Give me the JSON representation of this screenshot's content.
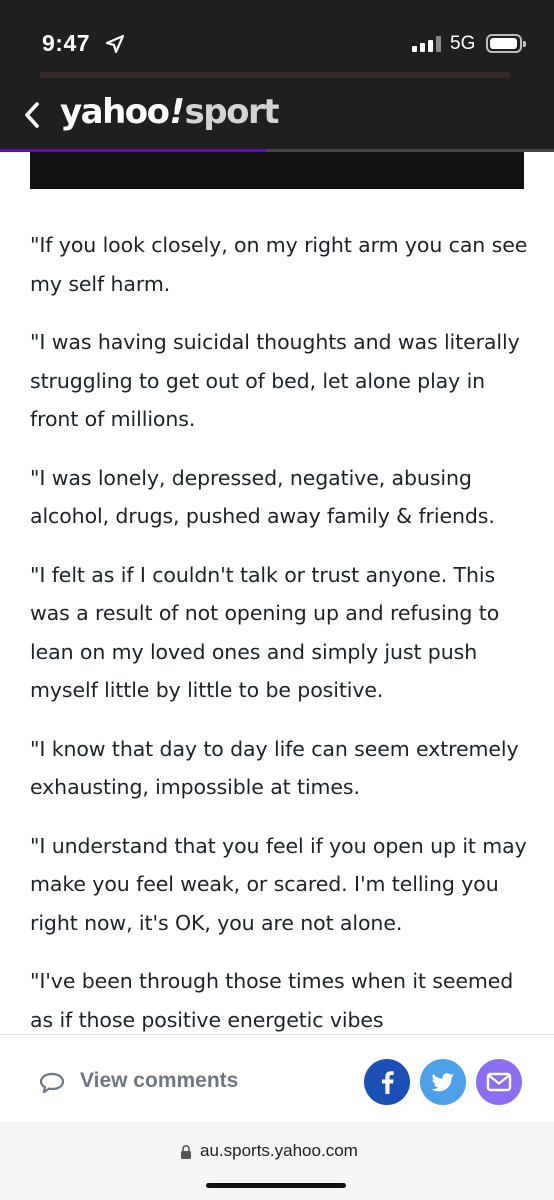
{
  "status_bar": {
    "time": "9:47",
    "network": "5G",
    "icons": [
      "location-arrow-icon",
      "signal-icon",
      "battery-icon"
    ]
  },
  "header": {
    "back_icon": "chevron-left-icon",
    "logo_main": "yahoo",
    "logo_excl": "!",
    "logo_sport": "sport",
    "read_progress": 0.48,
    "accent_color": "#6001d2"
  },
  "article": {
    "paragraphs": [
      "\"If you look closely, on my right arm you can see my self harm.",
      "\"I was having suicidal thoughts and was literally struggling to get out of bed, let alone play in front of millions.",
      "\"I was lonely, depressed, negative, abusing alcohol, drugs, pushed away family & friends.",
      "\"I felt as if I couldn't talk or trust anyone. This was a result of not opening up and refusing to lean on my loved ones and simply just push myself little by little to be positive.",
      "\"I know that day to day life can seem extremely exhausting, impossible at times.",
      "\"I understand that you feel if you open up it may make you feel weak, or scared. I'm telling you right now, it's OK, you are not alone.",
      "\"I've been through those times when it seemed as if those positive energetic vibes"
    ]
  },
  "bottom_bar": {
    "view_comments": "View comments",
    "share_icons": [
      "facebook-icon",
      "twitter-icon",
      "mail-icon"
    ],
    "colors": {
      "facebook": "#1a50b5",
      "twitter": "#4ba0e8",
      "mail": "#8b6ff0"
    }
  },
  "browser": {
    "url": "au.sports.yahoo.com"
  }
}
